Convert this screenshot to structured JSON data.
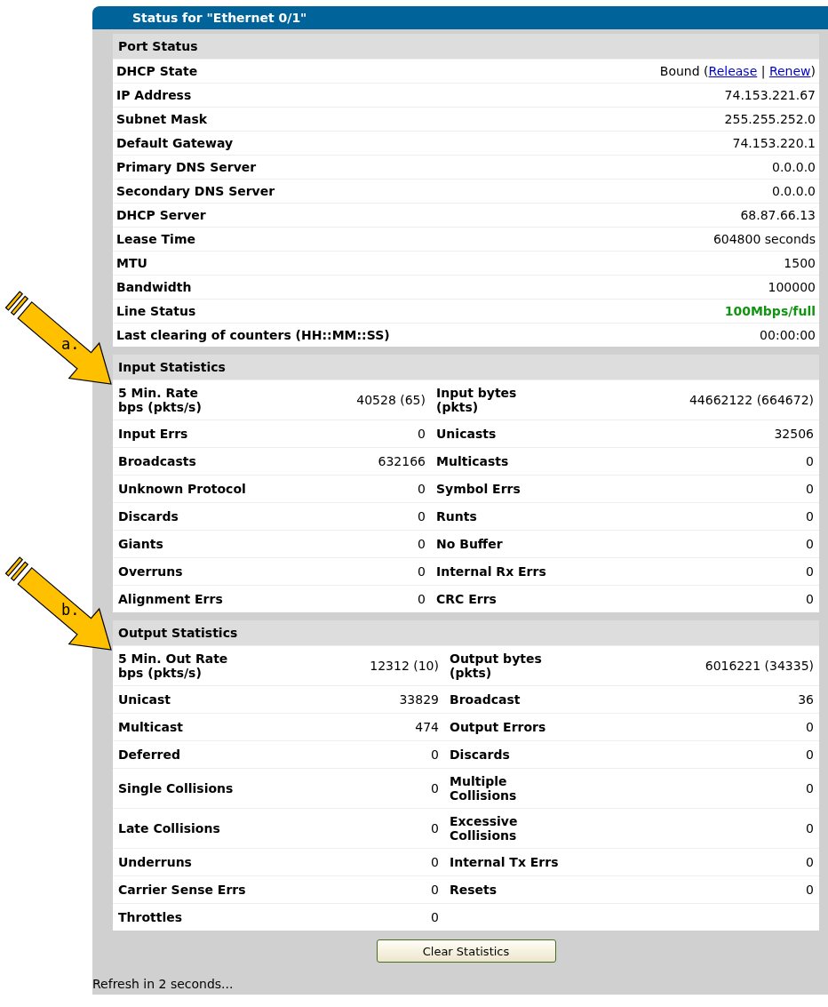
{
  "title": "Status for \"Ethernet 0/1\"",
  "port_status": {
    "heading": "Port Status",
    "rows": [
      {
        "kind": "parts",
        "label": "DHCP State",
        "parts": [
          {
            "text": "Bound (",
            "link": false
          },
          {
            "text": "Release",
            "link": true
          },
          {
            "text": " | ",
            "link": false
          },
          {
            "text": "Renew",
            "link": true
          },
          {
            "text": ")",
            "link": false
          }
        ]
      },
      {
        "kind": "text",
        "label": "IP Address",
        "value": "74.153.221.67"
      },
      {
        "kind": "text",
        "label": "Subnet Mask",
        "value": "255.255.252.0"
      },
      {
        "kind": "text",
        "label": "Default Gateway",
        "value": "74.153.220.1"
      },
      {
        "kind": "text",
        "label": "Primary DNS Server",
        "value": "0.0.0.0"
      },
      {
        "kind": "text",
        "label": "Secondary DNS Server",
        "value": "0.0.0.0"
      },
      {
        "kind": "text",
        "label": "DHCP Server",
        "value": "68.87.66.13"
      },
      {
        "kind": "text",
        "label": "Lease Time",
        "value": "604800 seconds"
      },
      {
        "kind": "text",
        "label": "MTU",
        "value": "1500"
      },
      {
        "kind": "text",
        "label": "Bandwidth",
        "value": "100000"
      },
      {
        "kind": "status",
        "label": "Line Status",
        "value": "100Mbps/full"
      },
      {
        "kind": "text",
        "label": "Last clearing of counters (HH::MM::SS)",
        "value": "00:00:00"
      }
    ]
  },
  "input_statistics": {
    "heading": "Input Statistics",
    "callout": "a.",
    "rows": [
      [
        {
          "label": "5 Min. Rate\nbps (pkts/s)",
          "value": "40528 (65)"
        },
        {
          "label": "Input bytes\n(pkts)",
          "value": "44662122 (664672)"
        }
      ],
      [
        {
          "label": "Input Errs",
          "value": "0"
        },
        {
          "label": "Unicasts",
          "value": "32506"
        }
      ],
      [
        {
          "label": "Broadcasts",
          "value": "632166"
        },
        {
          "label": "Multicasts",
          "value": "0"
        }
      ],
      [
        {
          "label": "Unknown Protocol",
          "value": "0"
        },
        {
          "label": "Symbol Errs",
          "value": "0"
        }
      ],
      [
        {
          "label": "Discards",
          "value": "0"
        },
        {
          "label": "Runts",
          "value": "0"
        }
      ],
      [
        {
          "label": "Giants",
          "value": "0"
        },
        {
          "label": "No Buffer",
          "value": "0"
        }
      ],
      [
        {
          "label": "Overruns",
          "value": "0"
        },
        {
          "label": "Internal Rx Errs",
          "value": "0"
        }
      ],
      [
        {
          "label": "Alignment Errs",
          "value": "0"
        },
        {
          "label": "CRC Errs",
          "value": "0"
        }
      ]
    ]
  },
  "output_statistics": {
    "heading": "Output Statistics",
    "callout": "b.",
    "rows": [
      [
        {
          "label": "5 Min. Out Rate\nbps (pkts/s)",
          "value": "12312 (10)"
        },
        {
          "label": "Output bytes\n(pkts)",
          "value": "6016221 (34335)"
        }
      ],
      [
        {
          "label": "Unicast",
          "value": "33829"
        },
        {
          "label": "Broadcast",
          "value": "36"
        }
      ],
      [
        {
          "label": "Multicast",
          "value": "474"
        },
        {
          "label": "Output Errors",
          "value": "0"
        }
      ],
      [
        {
          "label": "Deferred",
          "value": "0"
        },
        {
          "label": "Discards",
          "value": "0"
        }
      ],
      [
        {
          "label": "Single Collisions",
          "value": "0"
        },
        {
          "label": "Multiple\nCollisions",
          "value": "0"
        }
      ],
      [
        {
          "label": "Late Collisions",
          "value": "0"
        },
        {
          "label": "Excessive\nCollisions",
          "value": "0"
        }
      ],
      [
        {
          "label": "Underruns",
          "value": "0"
        },
        {
          "label": "Internal Tx Errs",
          "value": "0"
        }
      ],
      [
        {
          "label": "Carrier Sense Errs",
          "value": "0"
        },
        {
          "label": "Resets",
          "value": "0"
        }
      ],
      [
        {
          "label": "Throttles",
          "value": "0"
        }
      ]
    ]
  },
  "button": "Clear Statistics",
  "footer": "Refresh in 2 seconds..."
}
